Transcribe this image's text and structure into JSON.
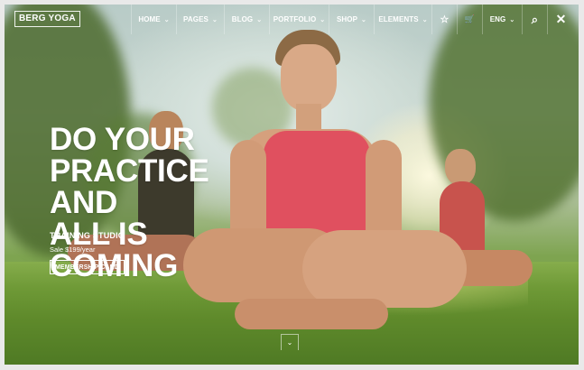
{
  "brand": {
    "logo_text": "BERG YOGA"
  },
  "nav": {
    "items": [
      {
        "label": "HOME",
        "has_dropdown": true
      },
      {
        "label": "PAGES",
        "has_dropdown": true
      },
      {
        "label": "BLOG",
        "has_dropdown": true
      },
      {
        "label": "PORTFOLIO",
        "has_dropdown": true
      },
      {
        "label": "SHOP",
        "has_dropdown": true
      },
      {
        "label": "ELEMENTS",
        "has_dropdown": true
      }
    ],
    "icons": [
      {
        "name": "favorites-icon",
        "glyph": "☆"
      },
      {
        "name": "cart-icon",
        "glyph": "🛒"
      }
    ],
    "language": "ENG",
    "search_glyph": "⌕",
    "close_glyph": "✕",
    "chevron_glyph": "⌄"
  },
  "hero": {
    "headline_lines": [
      "DO YOUR",
      "PRACTICE AND",
      "ALL IS COMING"
    ],
    "subhead": "TRAINING STUDIO",
    "price": "Sale $199/year",
    "cta_label": "MEMBERSHIP CARD",
    "scroll_glyph": "⌄"
  },
  "colors": {
    "text": "#ffffff",
    "tank_top": "#e0505f",
    "grass": "#6f9a37"
  }
}
